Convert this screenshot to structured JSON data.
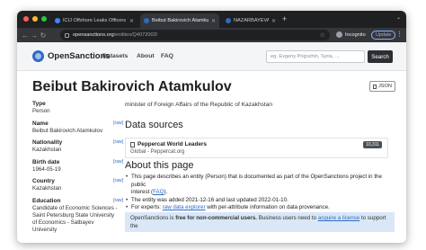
{
  "browser": {
    "tabs": [
      {
        "label": "ICIJ Offshore Leaks Officers",
        "favicon_color": "#4285f4"
      },
      {
        "label": "Beibut Bakirovich Atamkulov",
        "favicon_color": "#2f6bc2"
      },
      {
        "label": "NAZARBAYEVA Dariga Nursul",
        "favicon_color": "#2f6bc2"
      }
    ],
    "new_tab": "+",
    "url_host": "opensanctions.org",
    "url_path": "/entities/Q4072002/",
    "incognito_label": "Incognito",
    "update_label": "Update"
  },
  "site": {
    "brand": "OpenSanctions",
    "nav": {
      "datasets": "Datasets",
      "about": "About",
      "faq": "FAQ"
    },
    "search_placeholder": "eg. Evgeny Prigozhin, Syria, ...",
    "search_button": "Search"
  },
  "entity": {
    "title": "Beibut Bakirovich Atamkulov",
    "json_label": "JSON",
    "raw_label": "[raw]",
    "description": "minister of Foreign Affairs of the Republic of Kazakhstan",
    "facts": [
      {
        "label": "Type",
        "value": "Person",
        "raw": false
      },
      {
        "label": "Name",
        "value": "Beibut Bakirovich Atamkulov",
        "raw": true
      },
      {
        "label": "Nationality",
        "value": "Kazakhstan",
        "raw": true
      },
      {
        "label": "Birth date",
        "value": "1964-05-19",
        "raw": true
      },
      {
        "label": "Country",
        "value": "Kazakhstan",
        "raw": true
      },
      {
        "label": "Education",
        "value": "Candidate of Economic Sciences - Saint Petersburg State University of Economics - Satbayev University",
        "raw": true
      }
    ]
  },
  "data_sources": {
    "heading": "Data sources",
    "items": [
      {
        "name": "Peppercat World Leaders",
        "subtitle": "Global - Peppercat.org",
        "count": "10,311"
      }
    ]
  },
  "about": {
    "heading": "About this page",
    "line1a": "This page describes an entity (Person) that is documented as part of the OpenSanctions project in the public",
    "line1b": "interest (",
    "faq_link": "FAQ",
    "line1c": ").",
    "line2": "The entity was added 2021-12-16 and last updated 2022-01-10.",
    "line3a": "For experts: ",
    "explorer_link": "raw data explorer",
    "line3b": " with per-attribute information on data provenance."
  },
  "notice": {
    "prefix": "OpenSanctions is ",
    "bold": "free for non-commercial users.",
    "suffix": " Business users need to ",
    "link": "acquire a license",
    "end": " to support the"
  }
}
